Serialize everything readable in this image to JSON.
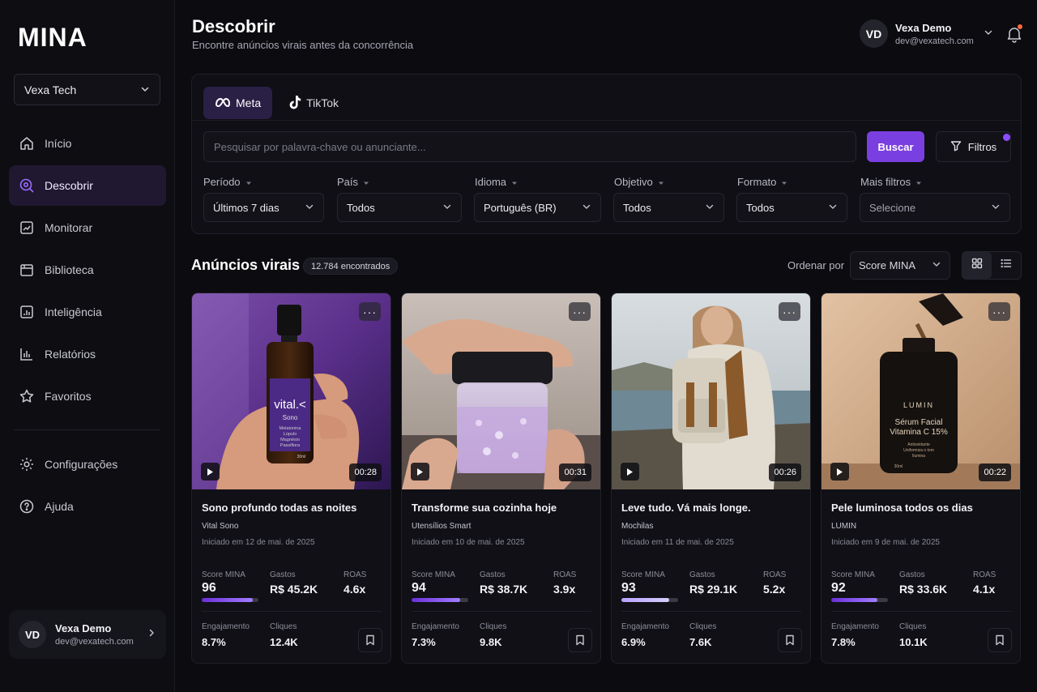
{
  "app": {
    "logo": "MINA"
  },
  "sidebar": {
    "workspace": "Vexa Tech",
    "items": [
      {
        "label": "Início",
        "icon": "home-icon"
      },
      {
        "label": "Descobrir",
        "icon": "discover-icon",
        "active": true
      },
      {
        "label": "Monitorar",
        "icon": "monitor-icon"
      },
      {
        "label": "Biblioteca",
        "icon": "library-icon"
      },
      {
        "label": "Inteligência",
        "icon": "intelligence-icon"
      },
      {
        "label": "Relatórios",
        "icon": "reports-icon"
      },
      {
        "label": "Favoritos",
        "icon": "star-icon"
      }
    ],
    "bottom_items": [
      {
        "label": "Configurações",
        "icon": "gear-icon"
      },
      {
        "label": "Ajuda",
        "icon": "help-icon"
      }
    ]
  },
  "user": {
    "initials": "VD",
    "name": "Vexa Demo",
    "email": "dev@vexatech.com"
  },
  "header": {
    "title": "Descobrir",
    "subtitle": "Encontre anúncios virais antes da concorrência"
  },
  "panel": {
    "tabs": [
      {
        "label": "Meta",
        "active": true
      },
      {
        "label": "TikTok",
        "active": false
      }
    ],
    "search_placeholder": "Pesquisar por palavra-chave ou anunciante...",
    "search_button": "Buscar",
    "filters_button": "Filtros",
    "filters": [
      {
        "label": "Período",
        "value": "Últimos 7 dias"
      },
      {
        "label": "País",
        "value": "Todos"
      },
      {
        "label": "Idioma",
        "value": "Português (BR)"
      },
      {
        "label": "Objetivo",
        "value": "Todos"
      },
      {
        "label": "Formato",
        "value": "Todos"
      },
      {
        "label": "Mais filtros",
        "value": "Selecione"
      }
    ]
  },
  "results": {
    "title": "Anúncios virais",
    "count": "12.784 encontrados",
    "sort_label": "Ordenar por",
    "sort_value": "Score MINA"
  },
  "metric_labels": {
    "score": "Score MINA",
    "spend": "Gastos",
    "roas": "ROAS",
    "engagement": "Engajamento",
    "clicks": "Cliques"
  },
  "cards": [
    {
      "title": "Sono profundo todas as noites",
      "brand": "Vital Sono",
      "date": "Iniciado em 12 de mai. de 2025",
      "duration": "00:28",
      "score": "96",
      "score_pct": 0.9,
      "spend": "R$ 45.2K",
      "roas": "4.6x",
      "engagement": "8.7%",
      "clicks": "12.4K",
      "thumb_text": [
        "vital.<",
        "Sono",
        "Melatonina",
        "Lúpulo",
        "Magnésio",
        "Passiflora",
        "30ml"
      ]
    },
    {
      "title": "Transforme sua cozinha hoje",
      "brand": "Utensílios Smart",
      "date": "Iniciado em 10 de mai. de 2025",
      "duration": "00:31",
      "score": "94",
      "score_pct": 0.86,
      "spend": "R$ 38.7K",
      "roas": "3.9x",
      "engagement": "7.3%",
      "clicks": "9.8K",
      "thumb_text": []
    },
    {
      "title": "Leve tudo. Vá mais longe.",
      "brand": "Mochilas",
      "date": "Iniciado em 11 de mai. de 2025",
      "duration": "00:26",
      "score": "93",
      "score_pct": 0.84,
      "spend": "R$ 29.1K",
      "roas": "5.2x",
      "engagement": "6.9%",
      "clicks": "7.6K",
      "thumb_text": []
    },
    {
      "title": "Pele luminosa todos os dias",
      "brand": "LUMIN",
      "date": "Iniciado em 9 de mai. de 2025",
      "duration": "00:22",
      "score": "92",
      "score_pct": 0.82,
      "spend": "R$ 33.6K",
      "roas": "4.1x",
      "engagement": "7.8%",
      "clicks": "10.1K",
      "thumb_text": [
        "LUMIN",
        "Sérum Facial",
        "Vitamina C 15%",
        "Antioxidante",
        "Uniformiza o tom",
        "Ilumina",
        "30ml"
      ]
    }
  ],
  "colors": {
    "accent": "#7a3fe0",
    "active_bg": "#201830",
    "background": "#0b0b10"
  }
}
